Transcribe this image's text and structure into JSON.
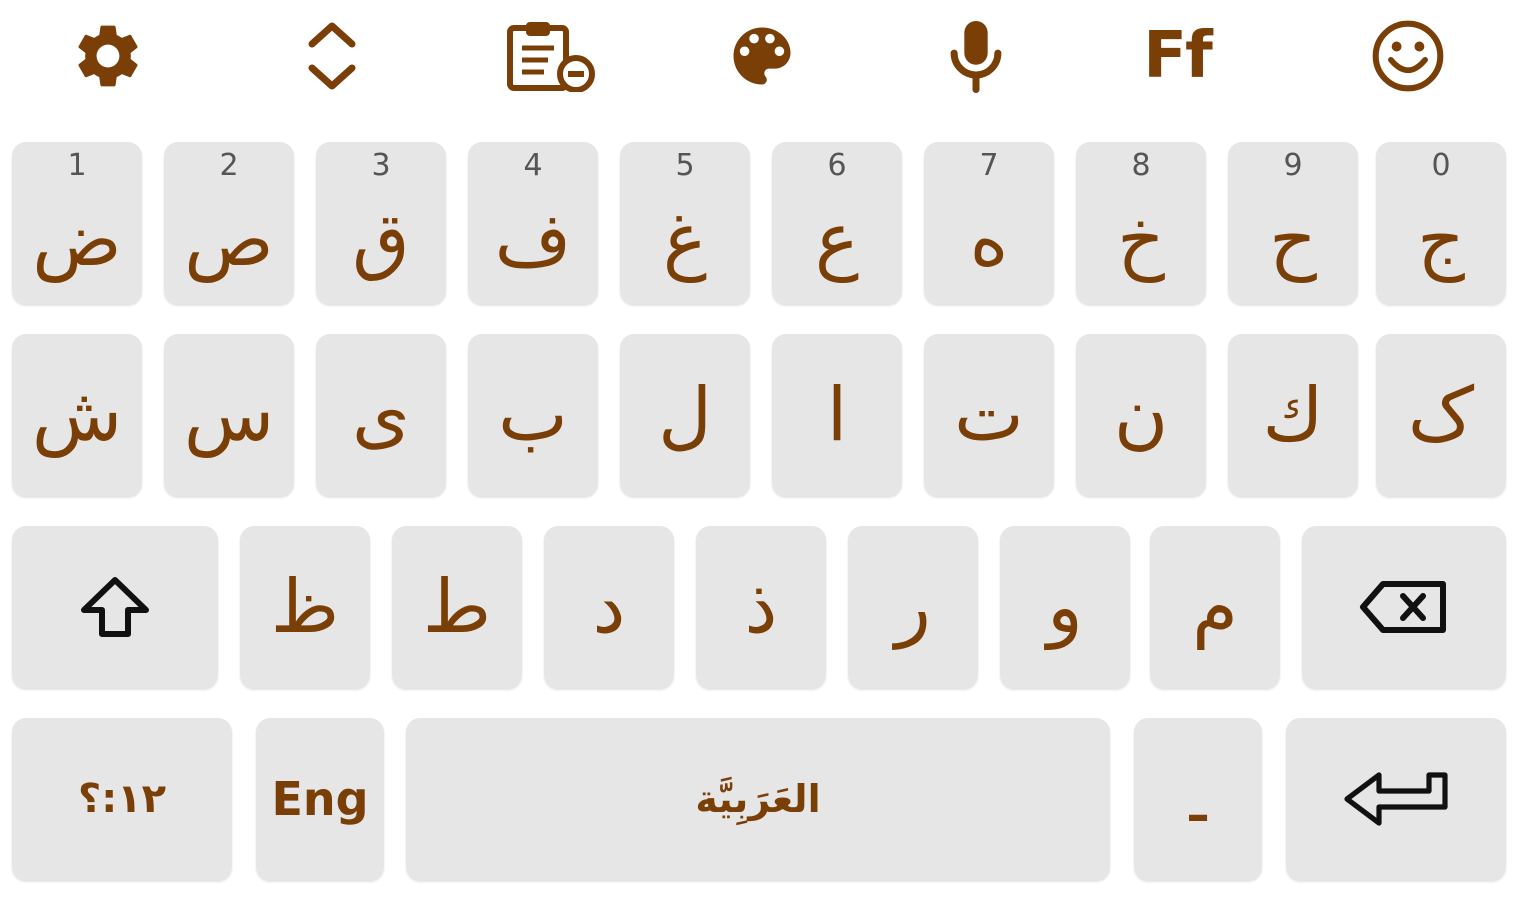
{
  "toolbar": {
    "items": [
      {
        "icon": "gear-icon",
        "label": ""
      },
      {
        "icon": "expand-collapse-icon",
        "label": ""
      },
      {
        "icon": "clipboard-icon",
        "label": ""
      },
      {
        "icon": "palette-icon",
        "label": ""
      },
      {
        "icon": "microphone-icon",
        "label": ""
      },
      {
        "icon": "font-icon",
        "label": "Ff"
      },
      {
        "icon": "emoji-icon",
        "label": ""
      }
    ]
  },
  "keyboard": {
    "row1": [
      {
        "char": "ض",
        "hint": "1"
      },
      {
        "char": "ص",
        "hint": "2"
      },
      {
        "char": "ق",
        "hint": "3"
      },
      {
        "char": "ف",
        "hint": "4"
      },
      {
        "char": "غ",
        "hint": "5"
      },
      {
        "char": "ع",
        "hint": "6"
      },
      {
        "char": "ه",
        "hint": "7"
      },
      {
        "char": "خ",
        "hint": "8"
      },
      {
        "char": "ح",
        "hint": "9"
      },
      {
        "char": "ج",
        "hint": "0"
      }
    ],
    "row2": [
      {
        "char": "ش"
      },
      {
        "char": "س"
      },
      {
        "char": "ى"
      },
      {
        "char": "ب"
      },
      {
        "char": "ل"
      },
      {
        "char": "ا"
      },
      {
        "char": "ت"
      },
      {
        "char": "ن"
      },
      {
        "char": "ك"
      },
      {
        "char": "ک"
      }
    ],
    "row3": [
      {
        "char": "ظ"
      },
      {
        "char": "ط"
      },
      {
        "char": "د"
      },
      {
        "char": "ذ"
      },
      {
        "char": "ر"
      },
      {
        "char": "و"
      },
      {
        "char": "م"
      }
    ],
    "shift_icon": "shift-arrow-icon",
    "backspace_icon": "backspace-icon",
    "symbols_label": "١٢:؟",
    "lang_label": "Eng",
    "space_label": "العَرَبِيَّة",
    "dash_label": "ـ",
    "enter_icon": "enter-arrow-icon"
  },
  "colors": {
    "accent": "#7a3e07",
    "key_bg": "#e6e6e6",
    "background": "#ffffff",
    "hint": "#555555"
  }
}
